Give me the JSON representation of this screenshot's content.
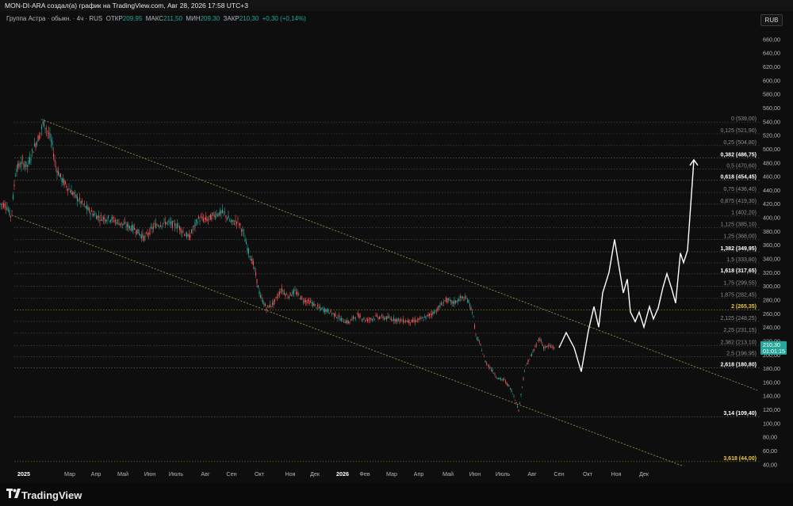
{
  "header": {
    "attribution": "MON-DI-ARA создал(а) график на TradingView.com, Авг 28, 2026 17:58 UTC+3"
  },
  "legend": {
    "symbol": "Группа Астра · обыкн. · 4ч · RUS",
    "open_label": "ОТКР",
    "open_value": "209,95",
    "high_label": "МАКС",
    "high_value": "211,50",
    "low_label": "МИН",
    "low_value": "209,30",
    "close_label": "ЗАКР",
    "close_value": "210,30",
    "change": "+0,30 (+0,14%)"
  },
  "currency": "RUB",
  "footer": {
    "brand": "TradingView"
  },
  "colors": {
    "background": "#0e0e0e",
    "up": "#26a69a",
    "down": "#ef5350",
    "projection": "#ffffff",
    "channel": "#d4c26a",
    "fib_line": "#8a8a8a",
    "highlight": "#e6c547"
  },
  "chart_data": {
    "type": "candlestick",
    "title": "",
    "x_tick_labels": [
      "2025",
      "Мар",
      "Апр",
      "Май",
      "Июн",
      "Июль",
      "Авг",
      "Сен",
      "Окт",
      "Ноя",
      "Дек",
      "2026",
      "Фев",
      "Мар",
      "Апр",
      "Май",
      "Июн",
      "Июль",
      "Авг",
      "Сен",
      "Окт",
      "Ноя",
      "Дек"
    ],
    "y_tick_labels": [
      "660,00",
      "640,00",
      "620,00",
      "600,00",
      "580,00",
      "560,00",
      "540,00",
      "520,00",
      "500,00",
      "480,00",
      "460,00",
      "440,00",
      "420,00",
      "400,00",
      "380,00",
      "360,00",
      "340,00",
      "320,00",
      "300,00",
      "280,00",
      "260,00",
      "240,00",
      "220,00",
      "200,00",
      "180,00",
      "160,00",
      "140,00",
      "120,00",
      "100,00",
      "80,00",
      "60,00",
      "40,00"
    ],
    "ylim": [
      30,
      672
    ],
    "last_price": {
      "value": "210,30",
      "countdown": "01:01:15"
    },
    "fib_levels": [
      {
        "label": "0 (539,00)",
        "value": 539,
        "emphasis": "normal"
      },
      {
        "label": "0,125 (521,90)",
        "value": 521.9,
        "emphasis": "normal"
      },
      {
        "label": "0,25 (504,80)",
        "value": 504.8,
        "emphasis": "normal"
      },
      {
        "label": "0,382 (486,75)",
        "value": 486.75,
        "emphasis": "bold"
      },
      {
        "label": "0,5 (470,60)",
        "value": 470.6,
        "emphasis": "normal"
      },
      {
        "label": "0,618 (454,45)",
        "value": 454.45,
        "emphasis": "bold"
      },
      {
        "label": "0,75 (436,40)",
        "value": 436.4,
        "emphasis": "normal"
      },
      {
        "label": "0,875 (419,30)",
        "value": 419.3,
        "emphasis": "normal"
      },
      {
        "label": "1 (402,20)",
        "value": 402.2,
        "emphasis": "normal"
      },
      {
        "label": "1,125 (385,10)",
        "value": 385.1,
        "emphasis": "normal"
      },
      {
        "label": "1,25 (368,00)",
        "value": 368,
        "emphasis": "normal"
      },
      {
        "label": "1,382 (349,95)",
        "value": 349.95,
        "emphasis": "bold"
      },
      {
        "label": "1,5 (333,80)",
        "value": 333.8,
        "emphasis": "normal"
      },
      {
        "label": "1,618 (317,65)",
        "value": 317.65,
        "emphasis": "bold"
      },
      {
        "label": "1,75 (299,55)",
        "value": 299.55,
        "emphasis": "normal"
      },
      {
        "label": "1,875 (282,45)",
        "value": 282.45,
        "emphasis": "normal"
      },
      {
        "label": "2 (265,35)",
        "value": 265.35,
        "emphasis": "yellow"
      },
      {
        "label": "2,125 (248,25)",
        "value": 248.25,
        "emphasis": "normal"
      },
      {
        "label": "2,25 (231,15)",
        "value": 231.15,
        "emphasis": "normal"
      },
      {
        "label": "2,382 (213,10)",
        "value": 213.1,
        "emphasis": "normal"
      },
      {
        "label": "2,5 (196,95)",
        "value": 196.95,
        "emphasis": "normal"
      },
      {
        "label": "2,618 (180,80)",
        "value": 180.8,
        "emphasis": "bold"
      },
      {
        "label": "3,14 (109,40)",
        "value": 109.4,
        "emphasis": "bold"
      },
      {
        "label": "3,618 (44,00)",
        "value": 44,
        "emphasis": "yellow"
      }
    ],
    "price_path": [
      [
        0,
        420
      ],
      [
        8,
        418
      ],
      [
        14,
        400
      ],
      [
        20,
        470
      ],
      [
        28,
        480
      ],
      [
        35,
        475
      ],
      [
        42,
        500
      ],
      [
        50,
        520
      ],
      [
        55,
        539
      ],
      [
        62,
        520
      ],
      [
        66,
        505
      ],
      [
        70,
        475
      ],
      [
        78,
        455
      ],
      [
        88,
        440
      ],
      [
        100,
        425
      ],
      [
        112,
        410
      ],
      [
        125,
        400
      ],
      [
        140,
        398
      ],
      [
        155,
        390
      ],
      [
        170,
        383
      ],
      [
        182,
        370
      ],
      [
        195,
        388
      ],
      [
        210,
        393
      ],
      [
        225,
        387
      ],
      [
        238,
        370
      ],
      [
        250,
        398
      ],
      [
        262,
        397
      ],
      [
        272,
        405
      ],
      [
        282,
        407
      ],
      [
        292,
        392
      ],
      [
        300,
        395
      ],
      [
        306,
        380
      ],
      [
        312,
        355
      ],
      [
        320,
        330
      ],
      [
        328,
        285
      ],
      [
        336,
        268
      ],
      [
        345,
        275
      ],
      [
        355,
        295
      ],
      [
        363,
        285
      ],
      [
        372,
        292
      ],
      [
        382,
        280
      ],
      [
        392,
        276
      ],
      [
        402,
        268
      ],
      [
        415,
        263
      ],
      [
        425,
        256
      ],
      [
        432,
        250
      ],
      [
        440,
        247
      ],
      [
        450,
        258
      ],
      [
        462,
        250
      ],
      [
        475,
        255
      ],
      [
        490,
        253
      ],
      [
        505,
        250
      ],
      [
        520,
        248
      ],
      [
        535,
        253
      ],
      [
        550,
        264
      ],
      [
        562,
        280
      ],
      [
        572,
        275
      ],
      [
        582,
        283
      ],
      [
        590,
        280
      ],
      [
        596,
        262
      ],
      [
        600,
        228
      ],
      [
        606,
        213
      ],
      [
        612,
        190
      ],
      [
        620,
        178
      ],
      [
        628,
        165
      ],
      [
        636,
        163
      ],
      [
        644,
        150
      ],
      [
        650,
        134
      ],
      [
        654,
        118
      ],
      [
        658,
        150
      ],
      [
        662,
        180
      ],
      [
        668,
        195
      ],
      [
        675,
        210
      ],
      [
        680,
        225
      ],
      [
        686,
        210
      ],
      [
        692,
        212
      ],
      [
        700,
        210
      ]
    ],
    "projection_path": [
      [
        705,
        210
      ],
      [
        714,
        232
      ],
      [
        724,
        210
      ],
      [
        733,
        175
      ],
      [
        742,
        235
      ],
      [
        749,
        270
      ],
      [
        755,
        240
      ],
      [
        760,
        290
      ],
      [
        768,
        320
      ],
      [
        775,
        368
      ],
      [
        781,
        325
      ],
      [
        786,
        290
      ],
      [
        791,
        310
      ],
      [
        795,
        262
      ],
      [
        801,
        248
      ],
      [
        806,
        262
      ],
      [
        812,
        240
      ],
      [
        819,
        270
      ],
      [
        824,
        252
      ],
      [
        830,
        268
      ],
      [
        836,
        298
      ],
      [
        841,
        318
      ],
      [
        847,
        296
      ],
      [
        852,
        275
      ],
      [
        858,
        348
      ],
      [
        862,
        334
      ],
      [
        867,
        352
      ],
      [
        875,
        484
      ]
    ],
    "channel_upper": [
      [
        52,
        543
      ],
      [
        955,
        148
      ]
    ],
    "channel_lower": [
      [
        15,
        403
      ],
      [
        860,
        38
      ]
    ]
  }
}
